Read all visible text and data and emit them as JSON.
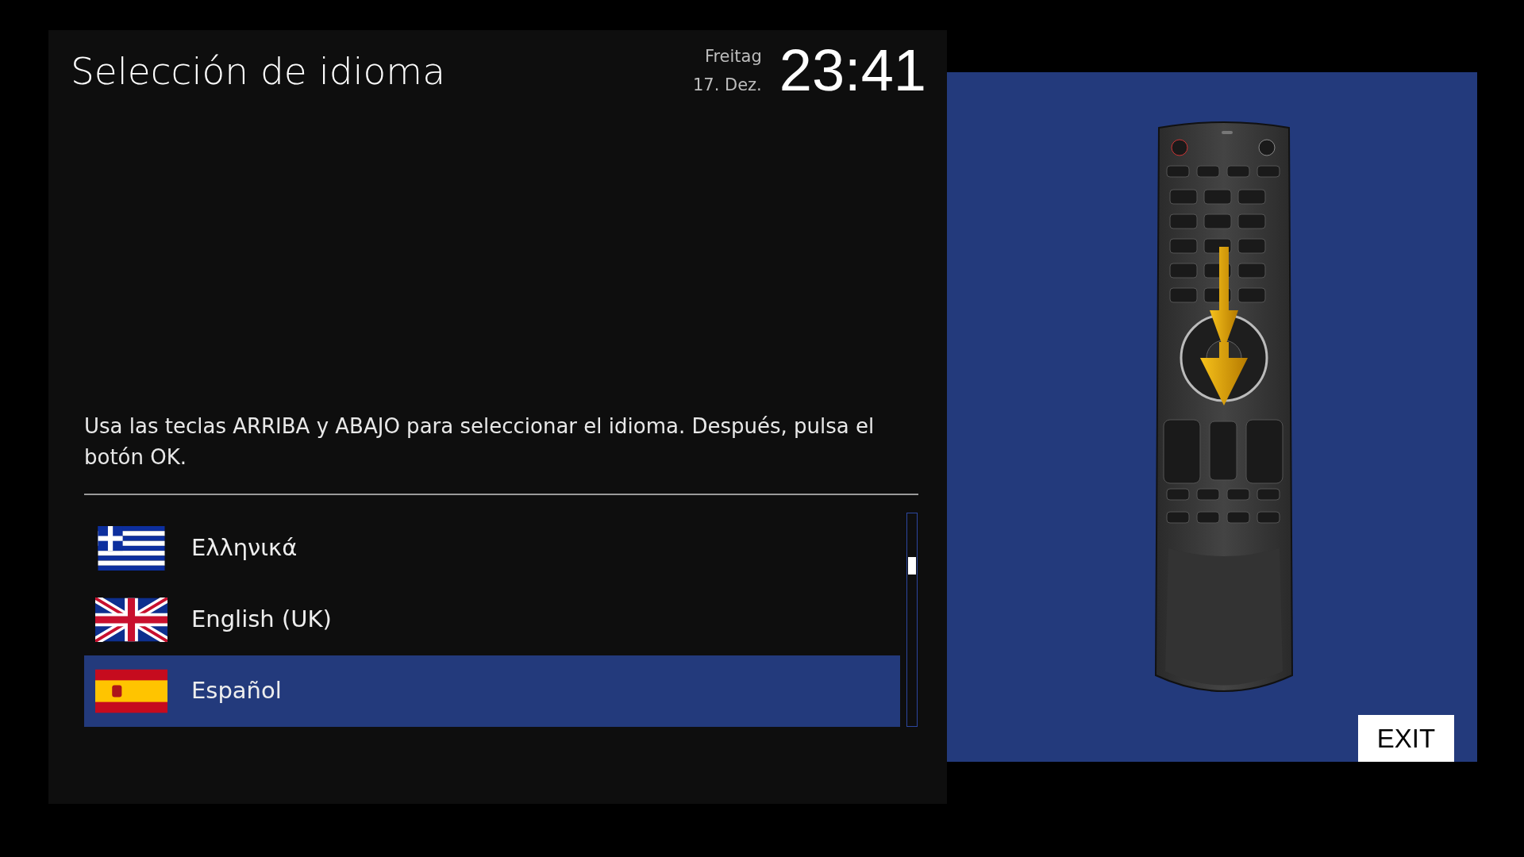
{
  "header": {
    "title": "Selección de idioma",
    "weekday": "Freitag",
    "date": "17. Dez.",
    "time": "23:41"
  },
  "instruction": "Usa las teclas ARRIBA y ABAJO para seleccionar el idioma. Después, pulsa el botón OK.",
  "languages": [
    {
      "label": "Ελληνικά",
      "kind": "greece",
      "selected": false
    },
    {
      "label": "English (UK)",
      "kind": "uk",
      "selected": false
    },
    {
      "label": "Español",
      "kind": "spain",
      "selected": true
    }
  ],
  "exit_button": "EXIT"
}
